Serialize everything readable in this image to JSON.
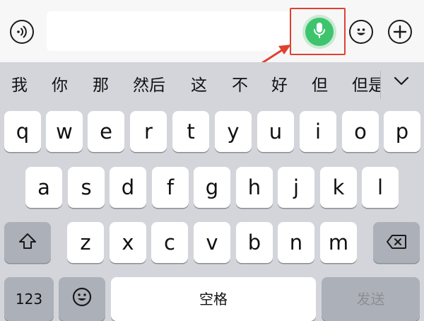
{
  "input_bar": {
    "voice_icon": "voice-wave-icon",
    "mic_icon": "microphone-icon",
    "emoji_icon": "emoji-icon",
    "plus_icon": "plus-icon",
    "highlight_color": "#e0412f",
    "mic_color": "#3ec46d"
  },
  "candidates": [
    "我",
    "你",
    "那",
    "然后",
    "这",
    "不",
    "好",
    "但",
    "但是"
  ],
  "collapse_icon": "chevron-down-icon",
  "keyboard": {
    "row1": [
      "q",
      "w",
      "e",
      "r",
      "t",
      "y",
      "u",
      "i",
      "o",
      "p"
    ],
    "row2": [
      "a",
      "s",
      "d",
      "f",
      "g",
      "h",
      "j",
      "k",
      "l"
    ],
    "row3": [
      "z",
      "x",
      "c",
      "v",
      "b",
      "n",
      "m"
    ],
    "shift_icon": "shift-icon",
    "delete_icon": "backspace-icon",
    "numbers_label": "123",
    "emoji_key_icon": "emoji-icon",
    "space_label": "空格",
    "send_label": "发送"
  }
}
